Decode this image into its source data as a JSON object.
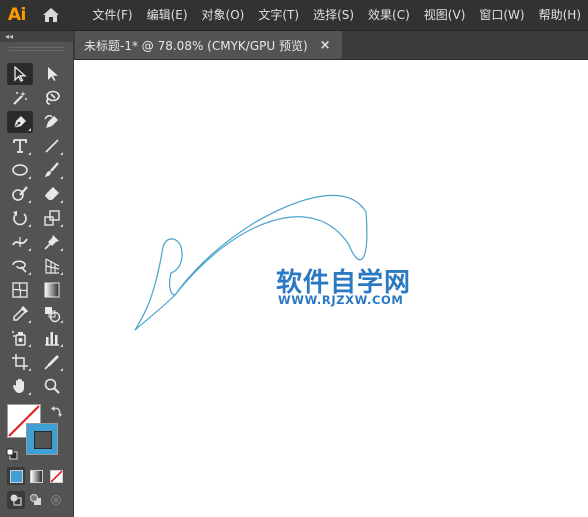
{
  "app": {
    "logo": "Ai",
    "home_icon": "home-icon"
  },
  "menu": [
    "文件(F)",
    "编辑(E)",
    "对象(O)",
    "文字(T)",
    "选择(S)",
    "效果(C)",
    "视图(V)",
    "窗口(W)",
    "帮助(H)"
  ],
  "panel": {
    "collapse_label": "◂◂"
  },
  "tools": [
    "selection-tool",
    "direct-selection-tool",
    "magic-wand-tool",
    "lasso-tool",
    "pen-tool",
    "curvature-tool",
    "type-tool",
    "line-segment-tool",
    "ellipse-tool",
    "paintbrush-tool",
    "shaper-tool",
    "eraser-tool",
    "rotate-tool",
    "scale-tool",
    "width-tool",
    "puppet-warp-tool",
    "free-transform-tool",
    "perspective-grid-tool",
    "mesh-tool",
    "gradient-tool",
    "eyedropper-tool",
    "blend-tool",
    "symbol-sprayer-tool",
    "column-graph-tool",
    "artboard-tool",
    "slice-tool",
    "hand-tool",
    "zoom-tool"
  ],
  "colors": {
    "fill": "#ffffff",
    "stroke": "#3ea0d4",
    "path": "#4aa3cc",
    "accent": "#ff9a00"
  },
  "document": {
    "tab_title": "未标题-1* @ 78.08% (CMYK/GPU 预览)",
    "close_label": "×"
  },
  "watermark": {
    "title": "软件自学网",
    "url": "WWW.RJZXW.COM"
  }
}
